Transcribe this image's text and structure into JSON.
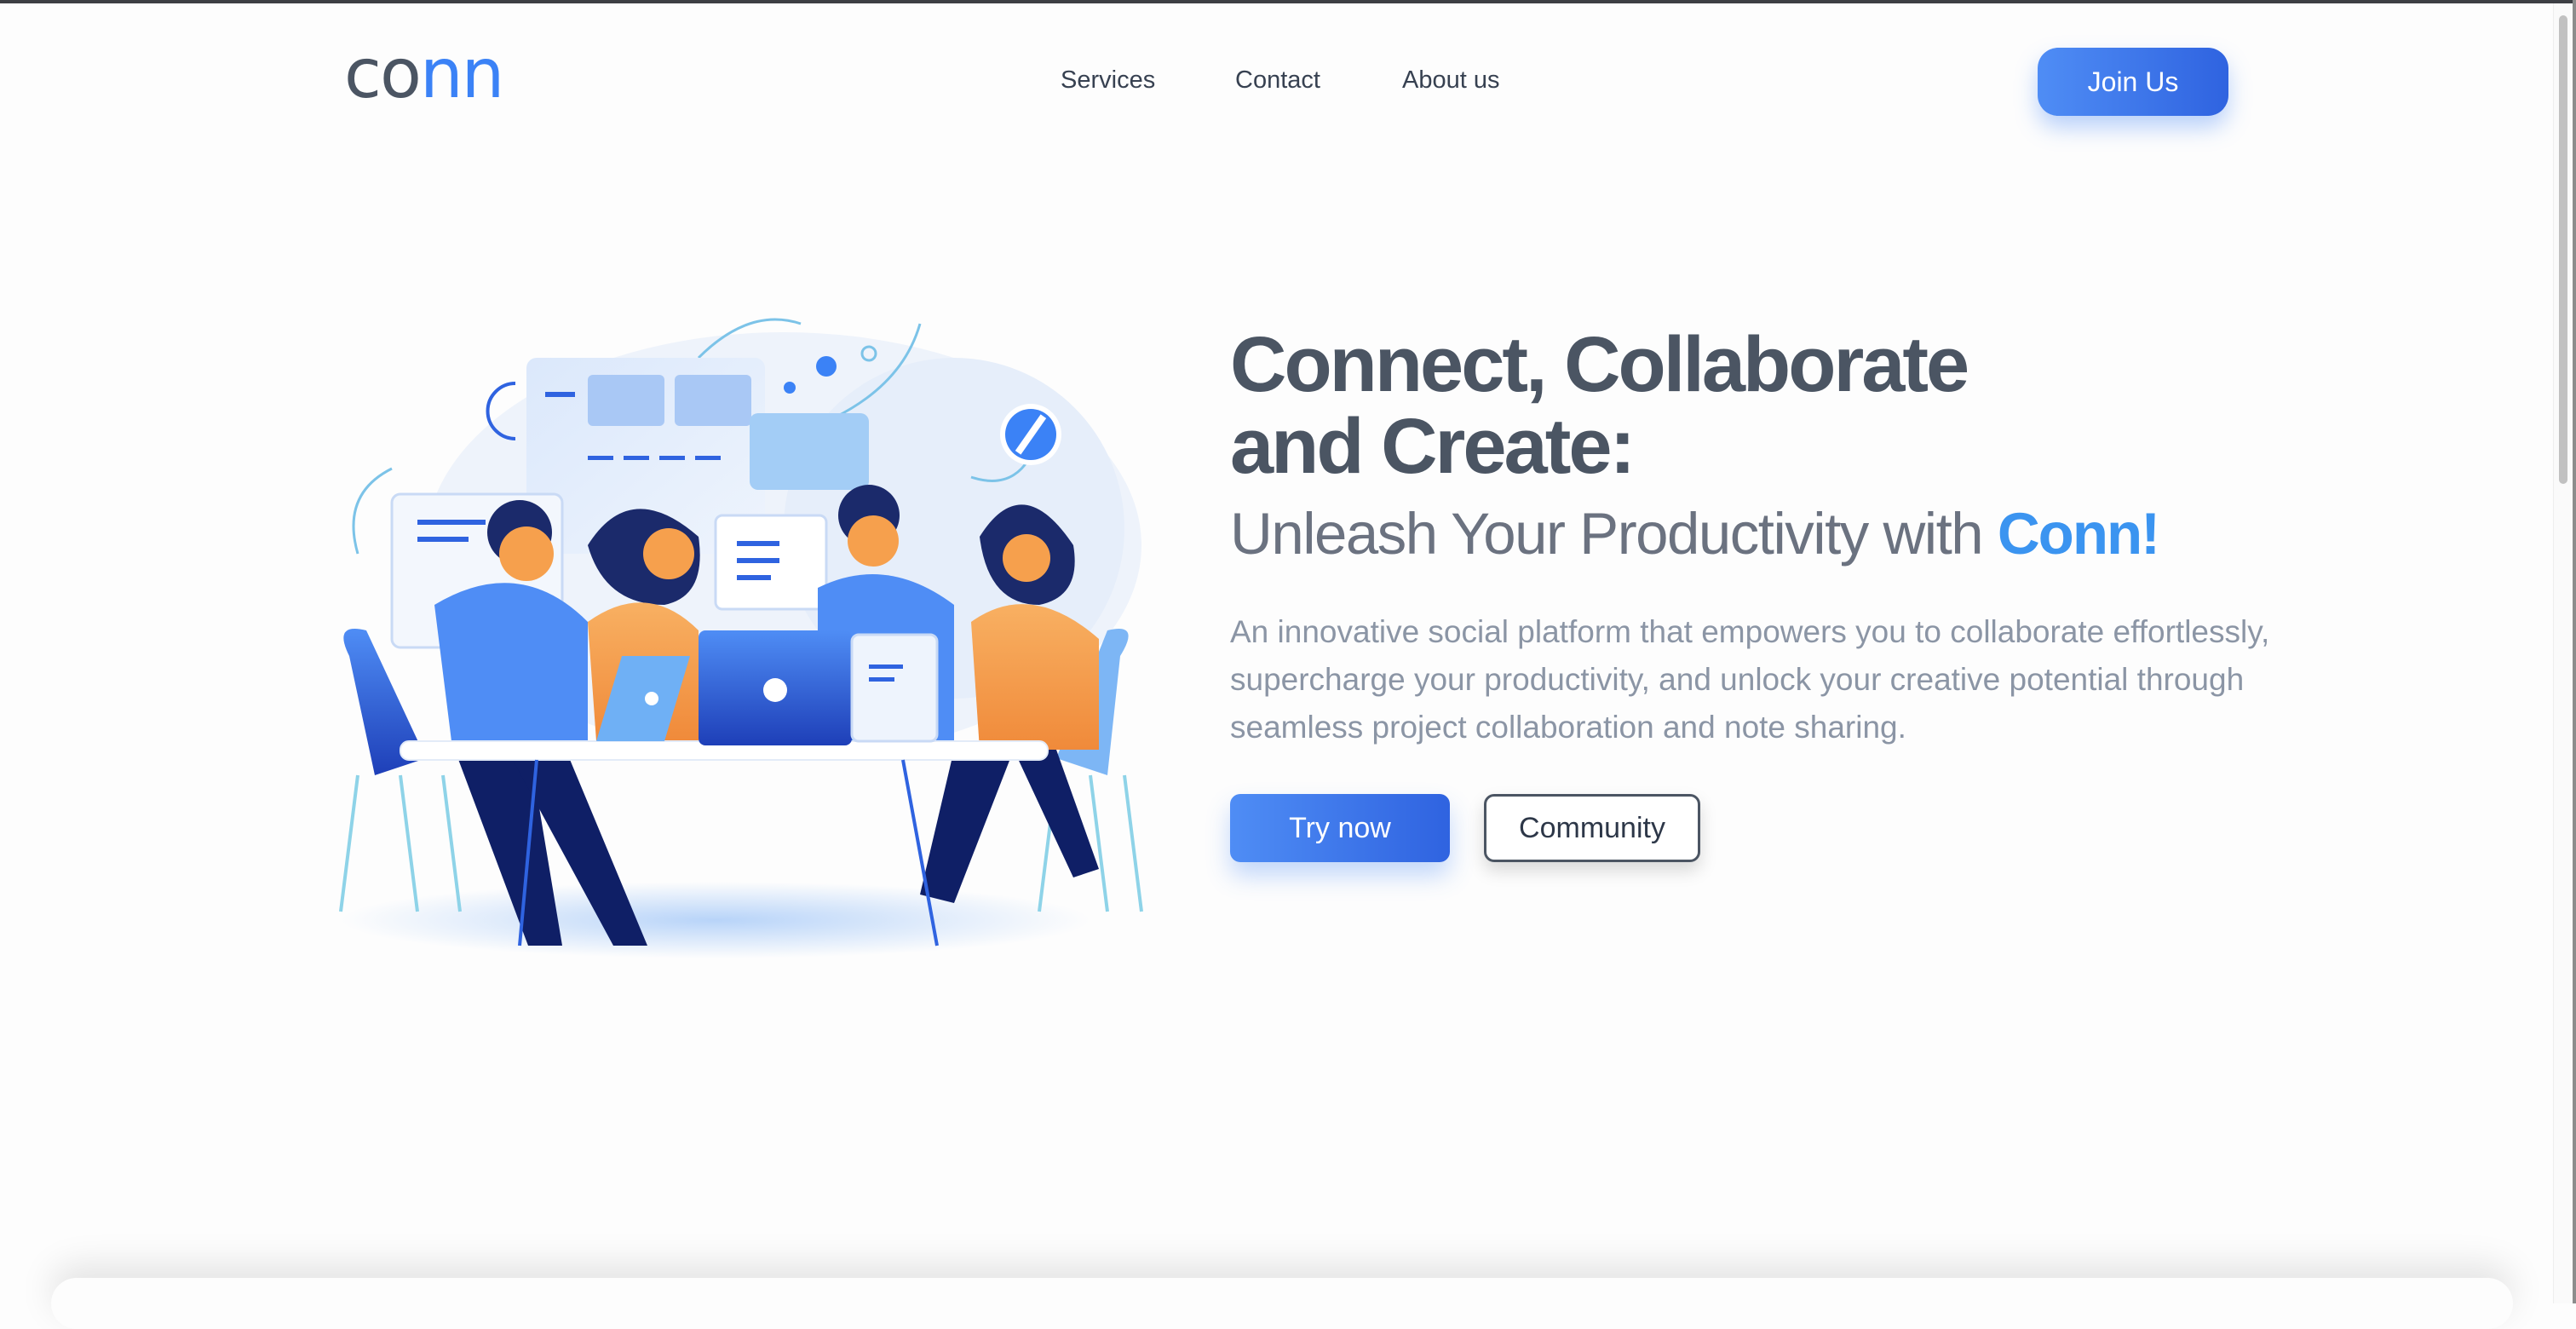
{
  "brand": {
    "logo_part1": "co",
    "logo_part2": "nn"
  },
  "nav": {
    "services": "Services",
    "contact": "Contact",
    "about": "About us"
  },
  "header": {
    "join_label": "Join Us"
  },
  "hero": {
    "title_line1": "Connect, Collaborate",
    "title_line2": "and Create:",
    "subtitle_prefix": "Unleash Your Productivity with ",
    "subtitle_brand": "Conn!",
    "description": "An innovative social platform that empowers you to collaborate effortlessly, supercharge your productivity, and unlock your creative potential through seamless project collaboration and note sharing.",
    "try_label": "Try now",
    "community_label": "Community"
  },
  "illustration": {
    "icon": "team-collaboration-illustration"
  },
  "colors": {
    "accent": "#3b82f6",
    "accent_dark": "#2f63e0",
    "text_dark": "#4b5563",
    "text_muted": "#8b95a5",
    "skin_orange": "#f6a04d"
  }
}
